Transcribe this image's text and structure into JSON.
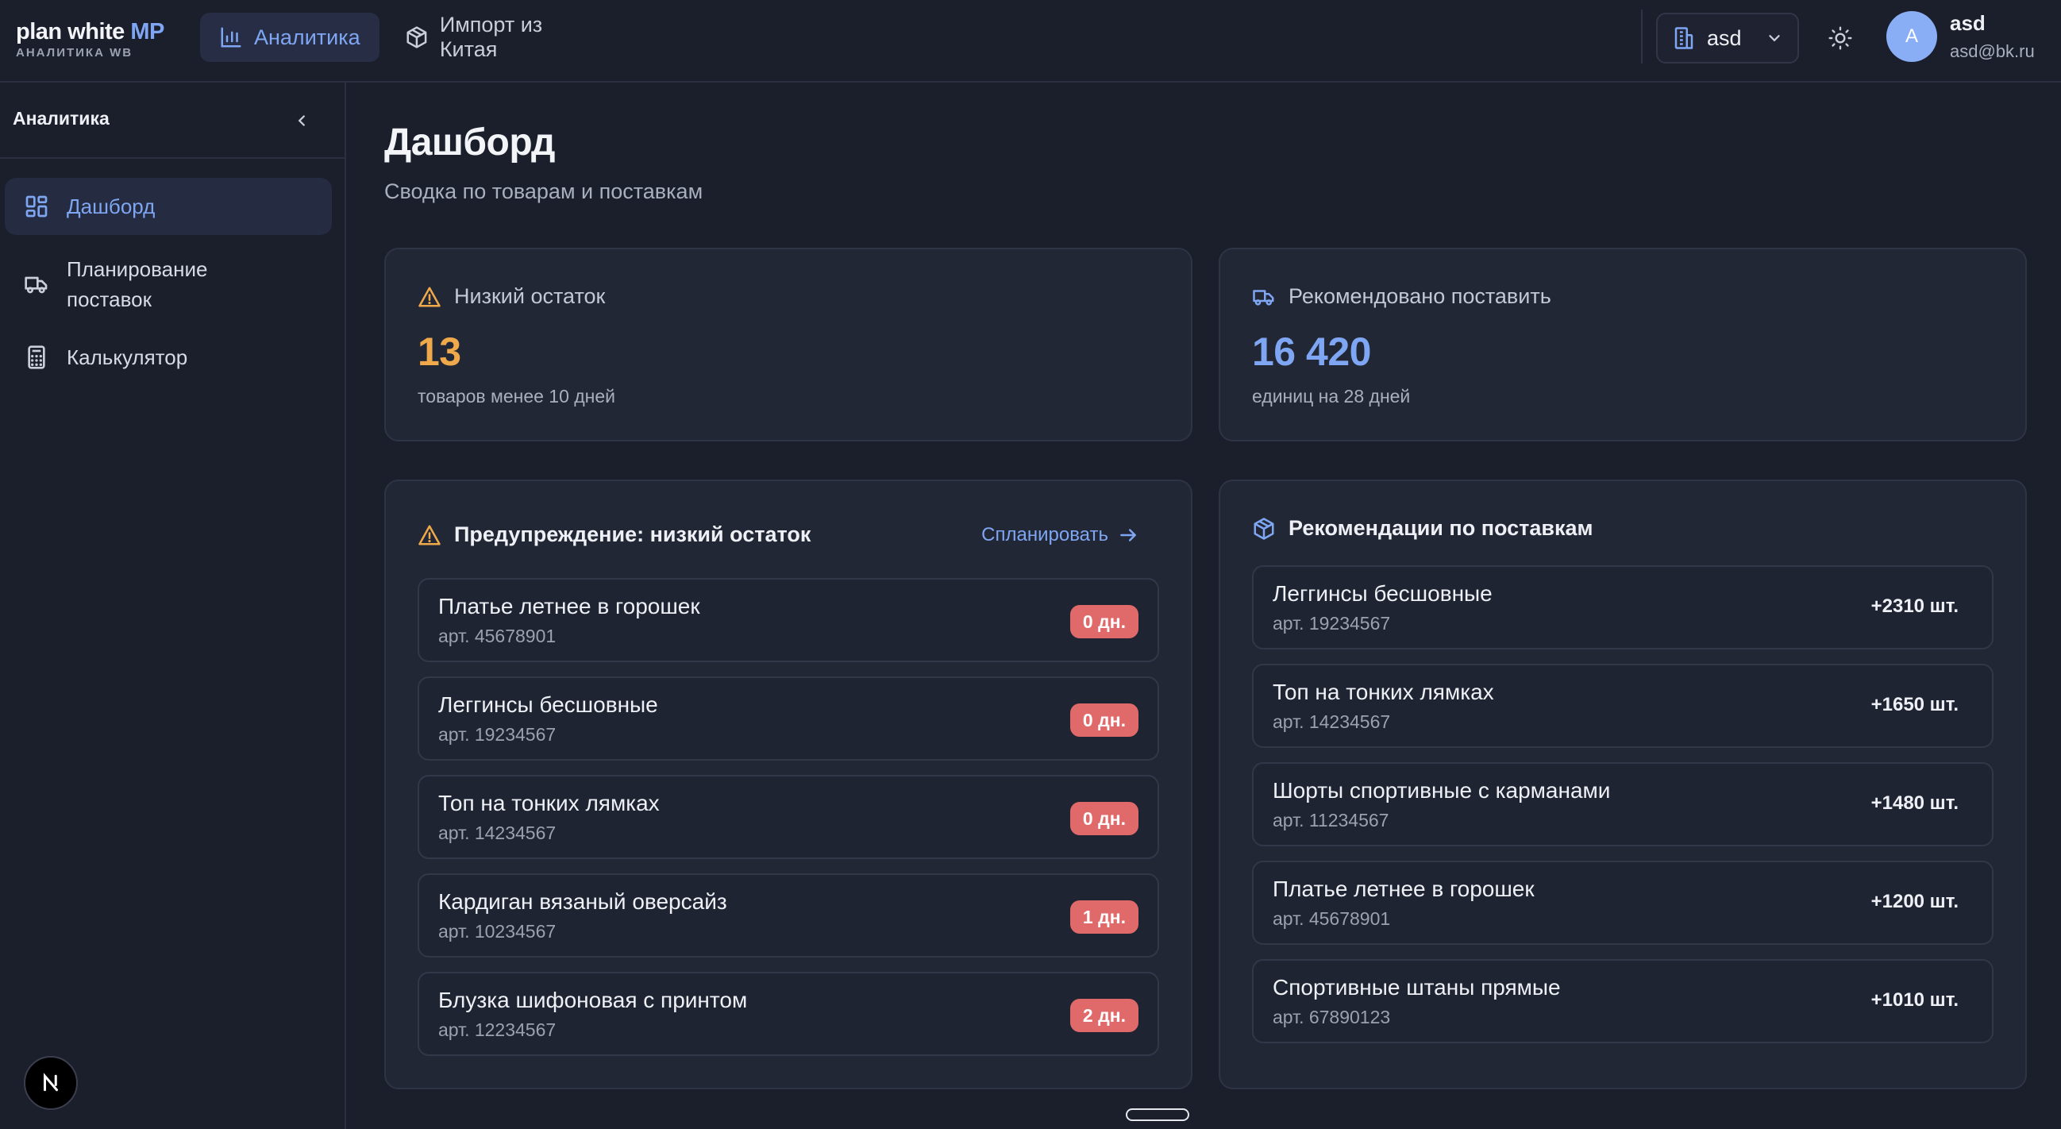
{
  "brand": {
    "title_main": "plan white",
    "title_accent": "MP",
    "subtitle": "АНАЛИТИКА WB"
  },
  "topnav": {
    "tabs": [
      {
        "label": "Аналитика",
        "icon": "bar-chart-icon",
        "active": true
      },
      {
        "label": "Импорт из Китая",
        "icon": "box-icon",
        "active": false
      }
    ]
  },
  "org": {
    "selected": "asd"
  },
  "user": {
    "initial": "A",
    "name": "asd",
    "email": "asd@bk.ru"
  },
  "sidebar": {
    "title": "Аналитика",
    "items": [
      {
        "label": "Дашборд",
        "icon": "dashboard-icon",
        "active": true
      },
      {
        "label": "Планирование поставок",
        "icon": "truck-icon",
        "active": false
      },
      {
        "label": "Калькулятор",
        "icon": "calculator-icon",
        "active": false
      }
    ]
  },
  "page": {
    "title": "Дашборд",
    "subtitle": "Сводка по товарам и поставкам"
  },
  "stats": {
    "low_stock": {
      "label": "Низкий остаток",
      "value": "13",
      "note": "товаров менее 10 дней",
      "color": "#f0a94a"
    },
    "recommended": {
      "label": "Рекомендовано поставить",
      "value": "16 420",
      "note": "единиц на 28 дней",
      "color": "#7ea6f2"
    }
  },
  "warning_panel": {
    "title": "Предупреждение: низкий остаток",
    "action": "Спланировать",
    "items": [
      {
        "name": "Платье летнее в горошек",
        "sku": "арт. 45678901",
        "days": "0 дн."
      },
      {
        "name": "Леггинсы бесшовные",
        "sku": "арт. 19234567",
        "days": "0 дн."
      },
      {
        "name": "Топ на тонких лямках",
        "sku": "арт. 14234567",
        "days": "0 дн."
      },
      {
        "name": "Кардиган вязаный оверсайз",
        "sku": "арт. 10234567",
        "days": "1 дн."
      },
      {
        "name": "Блузка шифоновая с принтом",
        "sku": "арт. 12234567",
        "days": "2 дн."
      }
    ]
  },
  "reco_panel": {
    "title": "Рекомендации по поставкам",
    "items": [
      {
        "name": "Леггинсы бесшовные",
        "sku": "арт. 19234567",
        "qty": "+2310 шт."
      },
      {
        "name": "Топ на тонких лямках",
        "sku": "арт. 14234567",
        "qty": "+1650 шт."
      },
      {
        "name": "Шорты спортивные с карманами",
        "sku": "арт. 11234567",
        "qty": "+1480 шт."
      },
      {
        "name": "Платье летнее в горошек",
        "sku": "арт. 45678901",
        "qty": "+1200 шт."
      },
      {
        "name": "Спортивные штаны прямые",
        "sku": "арт. 67890123",
        "qty": "+1010 шт."
      }
    ]
  },
  "colors": {
    "accent": "#7ea6f2",
    "warning": "#f0a94a",
    "danger_badge": "#e06a6a",
    "background": "#1b1f2b",
    "card": "#222736"
  }
}
